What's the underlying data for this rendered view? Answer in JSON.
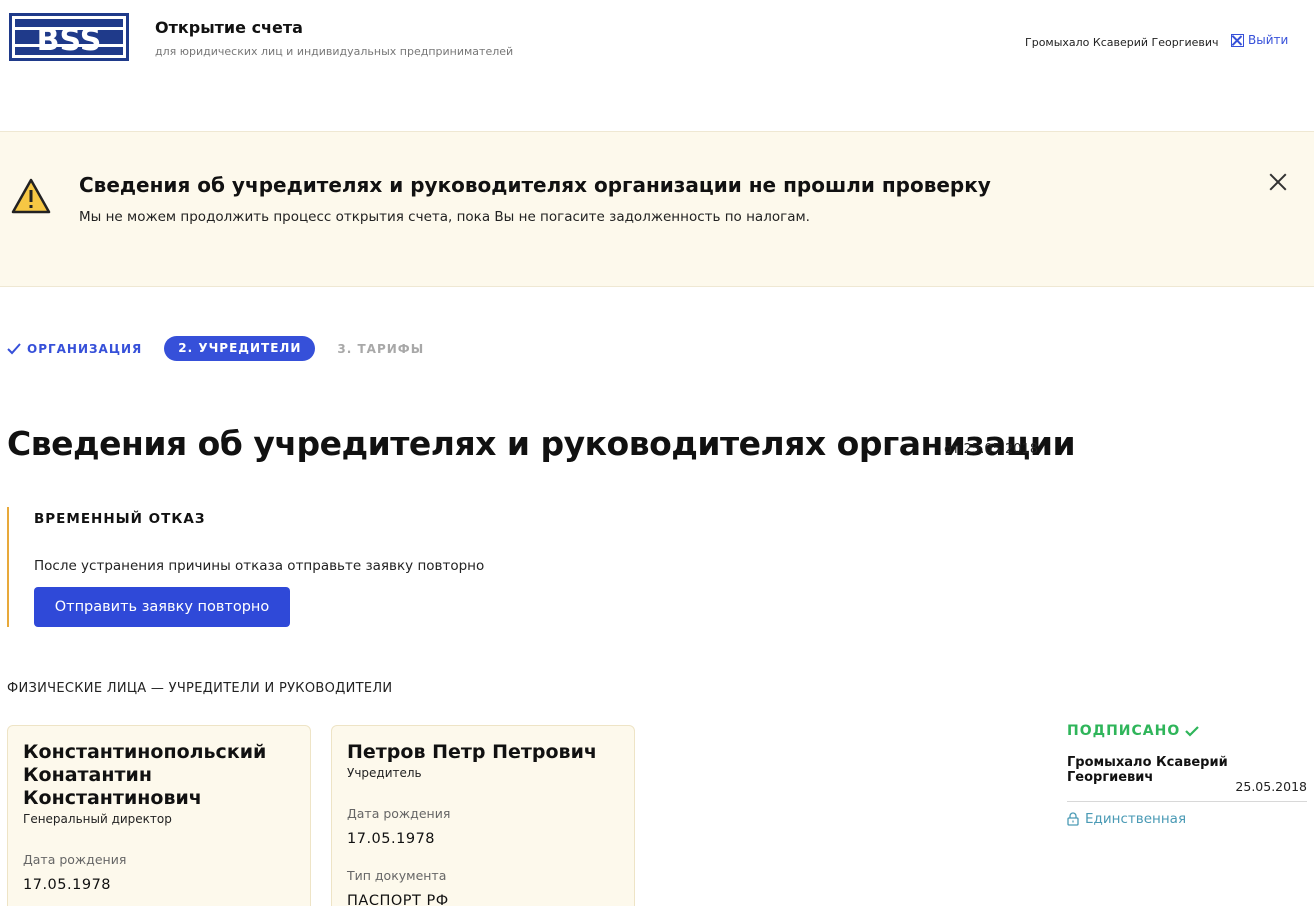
{
  "header": {
    "logo_text": "BSS",
    "title": "Открытие счета",
    "subtitle": "для юридических лиц и индивидуальных предпринимателей",
    "user_name": "Громыхало Ксаверий Георгиевич",
    "logout_label": "Выйти",
    "logout_icon": "logout-x-icon"
  },
  "alert": {
    "icon": "warning-triangle-icon",
    "title": "Сведения об учредителях и руководителях организации не прошли проверку",
    "text": "Мы не можем продолжить процесс открытия счета, пока Вы не погасите задолженность по налогам.",
    "close_icon": "close-icon",
    "background": "#fdf9ec"
  },
  "steps": [
    {
      "label": "ОРГАНИЗАЦИЯ",
      "state": "done"
    },
    {
      "label": "2. УЧРЕДИТЕЛИ",
      "state": "active"
    },
    {
      "label": "3. ТАРИФЫ",
      "state": "pending"
    }
  ],
  "page": {
    "title": "Сведения об учредителях и руководителях организации",
    "date": "от 25.05.2018"
  },
  "rejection": {
    "title": "ВРЕМЕННЫЙ ОТКАЗ",
    "text": "После устранения причины отказа отправьте заявку повторно",
    "button_label": "Отправить заявку повторно",
    "accent_color": "#e8a93a"
  },
  "persons_section": {
    "label": "ФИЗИЧЕСКИЕ ЛИЦА — УЧРЕДИТЕЛИ И РУКОВОДИТЕЛИ",
    "cards": [
      {
        "name": "Константинопольский Конатантин Константинович",
        "role": "Генеральный директор",
        "birth_label": "Дата рождения",
        "birth_date": "17.05.1978"
      },
      {
        "name": "Петров Петр Петрович",
        "role": "Учредитель",
        "birth_label": "Дата рождения",
        "birth_date": "17.05.1978",
        "doc_label": "Тип документа",
        "doc_type": "ПАСПОРТ РФ"
      }
    ]
  },
  "signature": {
    "status": "ПОДПИСАНО",
    "status_color": "#2fb55a",
    "signer": "Громыхало Ксаверий Георгиевич",
    "date": "25.05.2018",
    "type": "Единственная",
    "type_icon": "lock-icon"
  },
  "colors": {
    "primary": "#3650d9",
    "button": "#2f49d8",
    "success": "#2fb55a",
    "link_teal": "#4a9ab5"
  }
}
